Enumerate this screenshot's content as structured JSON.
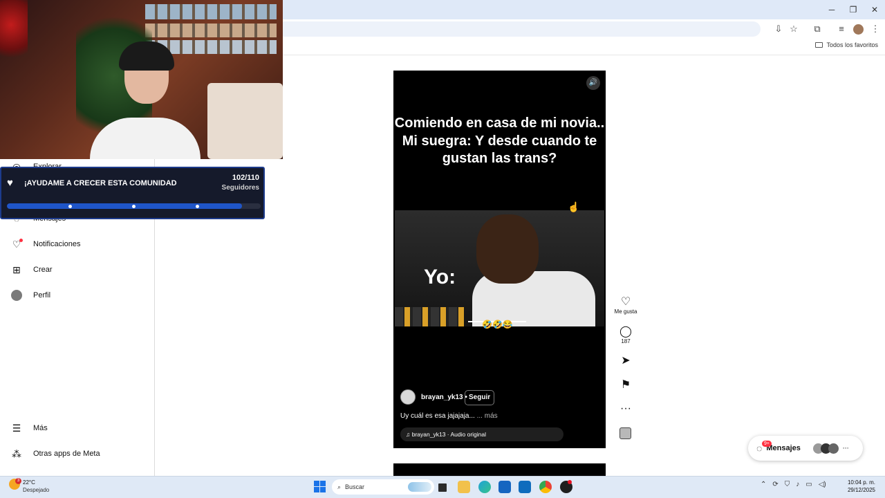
{
  "browser": {
    "bookmarks_label": "Todos los favoritos",
    "window_controls": [
      "─",
      "❐",
      "✕"
    ]
  },
  "sidebar": {
    "items": [
      {
        "label": "Explorar",
        "icon": "compass-icon"
      },
      {
        "label": "Mensajes",
        "icon": "messenger-icon"
      },
      {
        "label": "Notificaciones",
        "icon": "heart-icon"
      },
      {
        "label": "Crear",
        "icon": "plus-square-icon"
      },
      {
        "label": "Perfil",
        "icon": "avatar-icon"
      },
      {
        "label": "Más",
        "icon": "menu-icon"
      },
      {
        "label": "Otras apps de Meta",
        "icon": "meta-apps-icon"
      }
    ]
  },
  "goal": {
    "title": "¡AYUDAME A CRECER ESTA COMUNIDAD",
    "count": "102/110",
    "unit": "Seguidores",
    "progress": 0.927
  },
  "reel": {
    "overlay_text": "Comiendo en casa de mi novia..\nMi suegra: Y desde cuando te gustan las trans?",
    "clip_text": "Yo:",
    "clip_emojis": "🤣🤣😂",
    "username": "brayan_yk13",
    "dot": "•",
    "follow_label": "Seguir",
    "caption": "Uy cuál es esa jajajaja...",
    "caption_more": "... más",
    "audio": "brayan_yk13 · Audio original"
  },
  "actions": {
    "like_label": "Me gusta",
    "comments_count": "187"
  },
  "messages": {
    "label": "Mensajes",
    "badge": "9+"
  },
  "taskbar": {
    "temperature": "22°C",
    "condition": "Despejado",
    "weather_badge": "3",
    "search_placeholder": "Buscar",
    "time": "10:04 p. m.",
    "date": "29/12/2025"
  }
}
